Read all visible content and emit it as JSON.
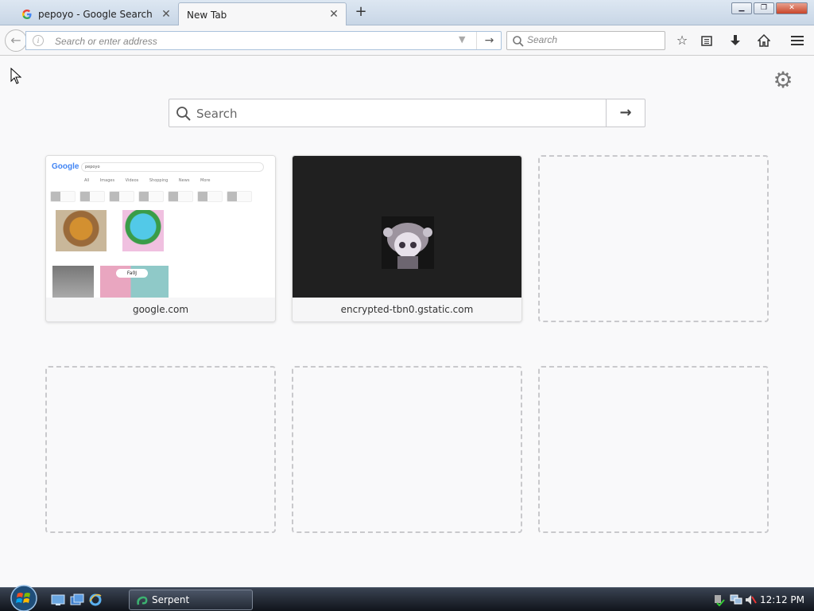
{
  "tabs": [
    {
      "title": "pepoyo - Google Search",
      "favicon": "google-g-icon"
    },
    {
      "title": "New Tab",
      "favicon": ""
    }
  ],
  "toolbar": {
    "url_placeholder": "Search or enter address",
    "search_placeholder": "Search",
    "icons": [
      "bookmark-star-icon",
      "reading-list-icon",
      "download-icon",
      "home-icon",
      "hamburger-menu-icon"
    ]
  },
  "newtab": {
    "search_placeholder": "Search",
    "tiles": [
      {
        "caption": "google.com"
      },
      {
        "caption": "encrypted-tbn0.gstatic.com"
      }
    ],
    "google_thumb": {
      "logo": "Google",
      "query": "pepoyo",
      "tabs": "All Images Videos Shopping News More",
      "bubble": "Fa0J"
    }
  },
  "taskbar": {
    "task_label": "Serpent",
    "clock": "12:12 PM"
  }
}
